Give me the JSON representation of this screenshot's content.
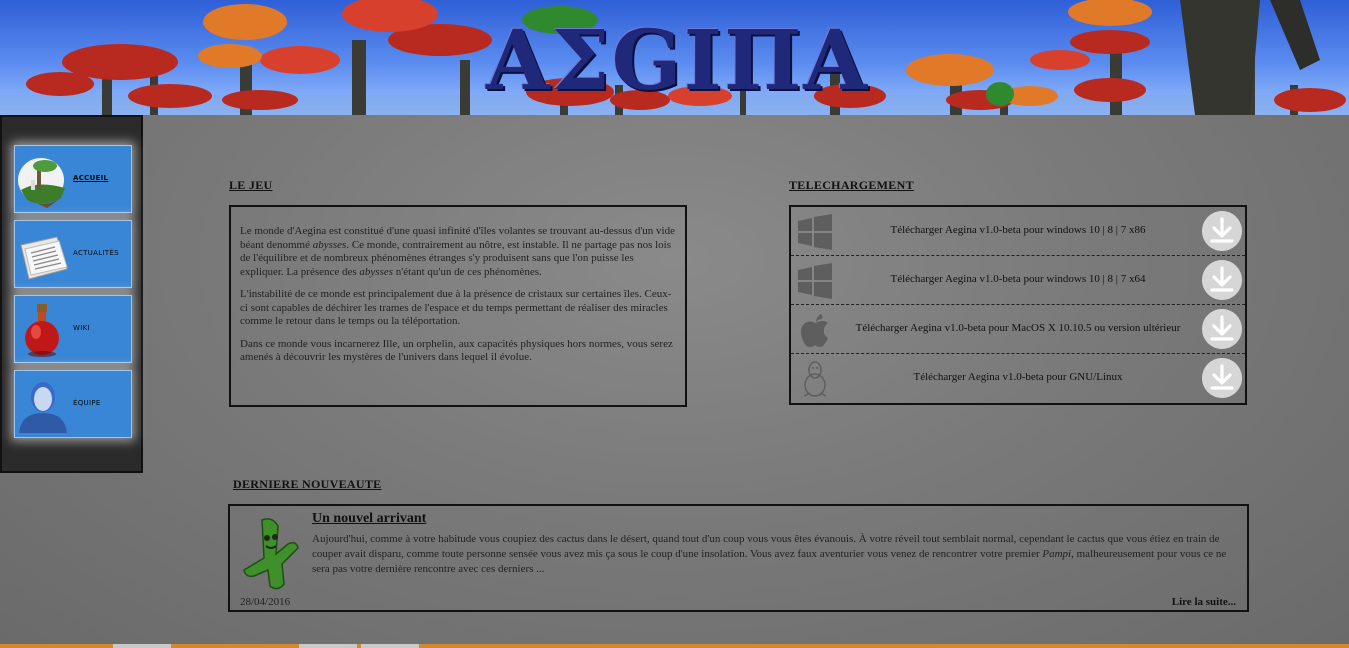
{
  "banner": {
    "title": "ΑΣGIΠΑ"
  },
  "sidebar": {
    "items": [
      {
        "label": "ACCUEIL",
        "icon": "island-icon",
        "active": true
      },
      {
        "label": "ACTUALITÉS",
        "icon": "newspaper-icon",
        "active": false
      },
      {
        "label": "WIKI",
        "icon": "potion-icon",
        "active": false
      },
      {
        "label": "ÉQUIPE",
        "icon": "person-icon",
        "active": false
      }
    ]
  },
  "game": {
    "title": "LE JEU",
    "p1": [
      "Le monde d'Aegina est constitué d'une quasi infinité d'îles volantes se trouvant au-dessus d'un vide béant denommé ",
      "abysses",
      ". Ce monde, contrairement au nôtre, est instable. Il ne partage pas nos lois de l'équilibre et de nombreux phénomènes étranges s'y produisent sans que l'on puisse les expliquer. La présence des ",
      "abysses",
      " n'étant qu'un de ces phénomènes."
    ],
    "p2": "L'instabilité de ce monde est principalement due à la présence de cristaux sur certaines îles. Ceux-ci sont capables de déchirer les trames de l'espace et du temps permettant de réaliser des miracles comme le retour dans le temps ou la téléportation.",
    "p3": "Dans ce monde vous incarnerez Ille, un orphelin, aux capacités physiques hors normes, vous serez amenés à découvrir les mystères de l'univers dans lequel il évolue."
  },
  "downloads": {
    "title": "TELECHARGEMENT",
    "items": [
      {
        "label": "Télécharger Aegina v1.0-beta pour windows 10 | 8 | 7 x86",
        "os_icon": "windows-icon"
      },
      {
        "label": "Télécharger Aegina v1.0-beta pour windows 10 | 8 | 7 x64",
        "os_icon": "windows-icon"
      },
      {
        "label": "Télécharger Aegina v1.0-beta pour MacOS X 10.10.5 ou version ultérieur",
        "os_icon": "apple-icon"
      },
      {
        "label": "Télécharger Aegina v1.0-beta pour GNU/Linux",
        "os_icon": "linux-icon"
      }
    ]
  },
  "news": {
    "title": "DERNIERE NOUVEAUTE",
    "heading": "Un nouvel arrivant",
    "text_before": "Aujourd'hui, comme à votre habitude vous coupiez des cactus dans le désert, quand tout d'un coup vous vous êtes évanouis. À votre réveil tout semblait normal, cependant le cactus que vous étiez en train de couper avait disparu, comme toute personne sensée vous avez mis ça sous le coup d'une insolation. Vous avez faux aventurier vous venez de rencontrer votre premier ",
    "text_em": "Pampi",
    "text_after": ", malheureusement pour vous ce ne sera pas votre dernière rencontre avec ces derniers ...",
    "date": "28/04/2016",
    "more": "Lire la suite..."
  },
  "colors": {
    "nav_tile": "#3a86d6",
    "sidebar_bg": "#2b2b2b",
    "page_bg": "#7a7a7a",
    "download_button": "#dadada"
  }
}
